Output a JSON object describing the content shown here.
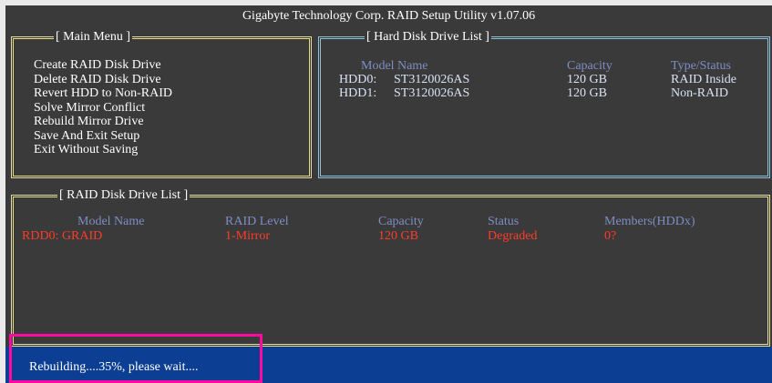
{
  "window": {
    "title": "Gigabyte Technology Corp.  RAID Setup Utility  v1.07.06"
  },
  "main_menu": {
    "label": "[ Main Menu ]",
    "items": [
      "Create RAID Disk Drive",
      "Delete RAID Disk Drive",
      "Revert HDD to Non-RAID",
      "Solve Mirror Conflict",
      "Rebuild Mirror Drive",
      "Save And Exit Setup",
      "Exit Without Saving"
    ]
  },
  "hdd_list": {
    "label": "[ Hard Disk Drive List ]",
    "headers": {
      "model": "Model Name",
      "capacity": "Capacity",
      "type": "Type/Status"
    },
    "rows": [
      {
        "id": "HDD0:",
        "model": "ST3120026AS",
        "capacity": "120 GB",
        "type": "RAID Inside"
      },
      {
        "id": "HDD1:",
        "model": "ST3120026AS",
        "capacity": "120 GB",
        "type": "Non-RAID"
      }
    ]
  },
  "raid_list": {
    "label": "[ RAID Disk Drive List ]",
    "headers": {
      "model": "Model Name",
      "level": "RAID Level",
      "capacity": "Capacity",
      "status": "Status",
      "members": "Members(HDDx)"
    },
    "rows": [
      {
        "model": "RDD0: GRAID",
        "level": "1-Mirror",
        "capacity": "120 GB",
        "status": "Degraded",
        "members": "0?"
      }
    ]
  },
  "status_bar": {
    "text": "Rebuilding....35%, please wait...."
  },
  "colors": {
    "background": "#3a3a3a",
    "yellow_border": "#e6dd96",
    "blue_border": "#8cc0d8",
    "header_text": "#7f8dc4",
    "raid_row_text": "#ff3c28",
    "status_bar": "#0c3f93",
    "highlight": "#ff0a9e"
  }
}
